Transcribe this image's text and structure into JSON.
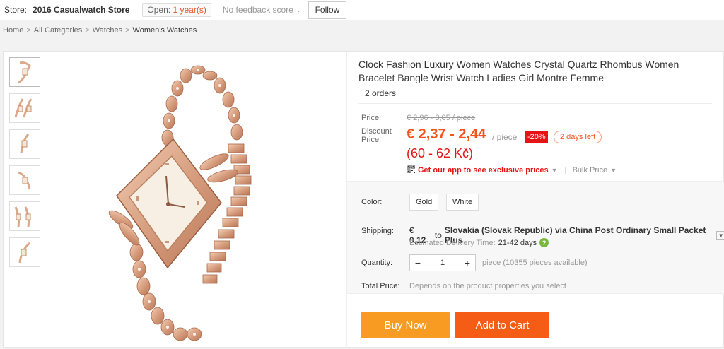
{
  "store": {
    "label": "Store:",
    "name": "2016 Casualwatch Store",
    "open_prefix": "Open:",
    "open_years": "1 year(s)",
    "feedback": "No feedback score",
    "follow": "Follow"
  },
  "breadcrumb": [
    "Home",
    "All Categories",
    "Watches",
    "Women's Watches"
  ],
  "product": {
    "title": "Clock Fashion Luxury Women Watches Crystal Quartz Rhombus Women Bracelet Bangle Wrist Watch Ladies Girl Montre Femme",
    "orders": "2 orders"
  },
  "price": {
    "price_label": "Price:",
    "original": "€ 2,96 - 3,05 / piece",
    "discount_label": "Discount Price:",
    "discount": "€ 2,37 - 2,44",
    "per_piece": "/ piece",
    "discount_pct": "-20%",
    "days_left": "2 days left",
    "local": "(60 - 62 Kč)",
    "app_link": "Get our app to see exclusive prices",
    "bulk": "Bulk Price"
  },
  "options": {
    "color_label": "Color:",
    "colors": [
      "Gold",
      "White"
    ],
    "shipping_label": "Shipping:",
    "shipping_cost": "€ 0,12",
    "shipping_to": "to",
    "shipping_dest": "Slovakia (Slovak Republic) via China Post Ordinary Small Packet Plus",
    "delivery_label": "Estimated Delivery Time:",
    "delivery_days": "21-42 days",
    "quantity_label": "Quantity:",
    "quantity": "1",
    "quantity_note": "piece (10355 pieces available)",
    "total_label": "Total Price:",
    "total_note": "Depends on the product properties you select"
  },
  "actions": {
    "buy_now": "Buy Now",
    "add_to_cart": "Add to Cart"
  },
  "colors": {
    "accent": "#f2521b",
    "buy": "#f79b22",
    "cart": "#f55c16",
    "discount_badge": "#e61414"
  },
  "icons": [
    "chevron-down-icon",
    "qr-code-icon",
    "help-icon",
    "minus-icon",
    "plus-icon"
  ]
}
